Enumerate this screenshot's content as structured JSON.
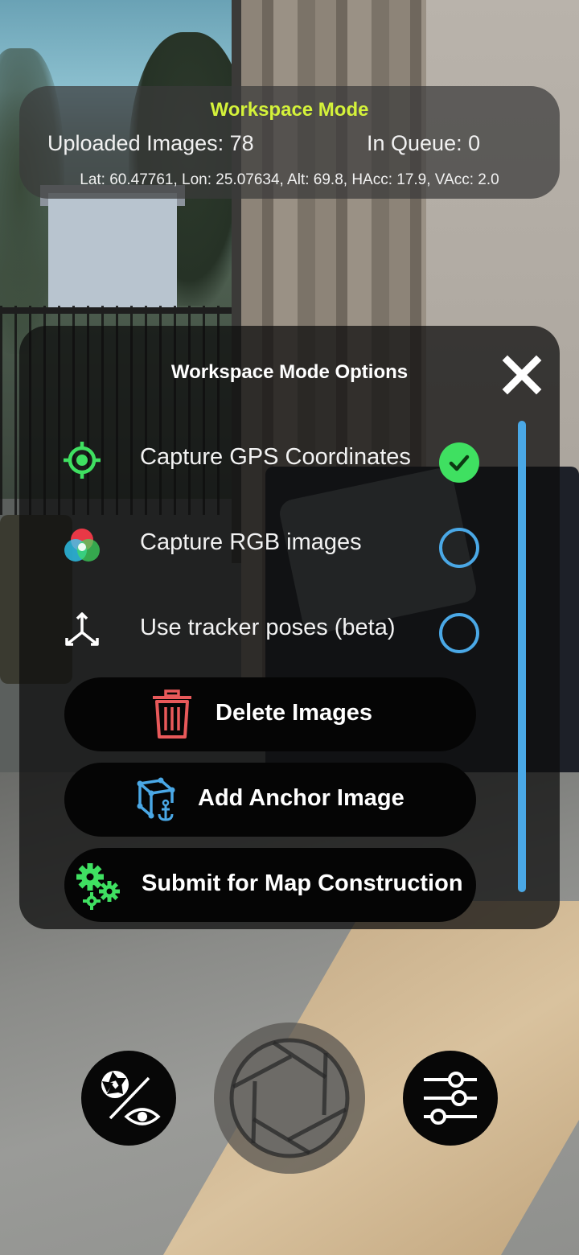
{
  "status": {
    "title": "Workspace Mode",
    "uploaded": "Uploaded Images: 78",
    "queue": "In Queue: 0",
    "gps": "Lat: 60.47761, Lon: 25.07634, Alt: 69.8, HAcc: 17.9, VAcc: 2.0"
  },
  "panel": {
    "title": "Workspace Mode Options",
    "options": [
      {
        "label": "Capture GPS Coordinates",
        "checked": true,
        "icon": "gps-target-icon"
      },
      {
        "label": "Capture RGB images",
        "checked": false,
        "icon": "rgb-circles-icon"
      },
      {
        "label": "Use tracker poses (beta)",
        "checked": false,
        "icon": "axes-icon"
      }
    ],
    "actions": [
      {
        "label": "Delete Images",
        "icon": "trash-icon"
      },
      {
        "label": "Add Anchor Image",
        "icon": "anchor-cube-icon"
      },
      {
        "label": "Submit for Map Construction",
        "icon": "gears-icon"
      }
    ]
  },
  "colors": {
    "accent_title": "#d4f23a",
    "check_on": "#3fe061",
    "check_off": "#4aa8e6",
    "scrollbar": "#4aa8e6",
    "delete_icon": "#e8595a",
    "anchor_icon": "#4aa8e6",
    "gears_icon": "#3fe061"
  },
  "controls": {
    "left_icon": "shutter-eye-toggle-icon",
    "center_icon": "shutter-icon",
    "right_icon": "sliders-icon"
  }
}
